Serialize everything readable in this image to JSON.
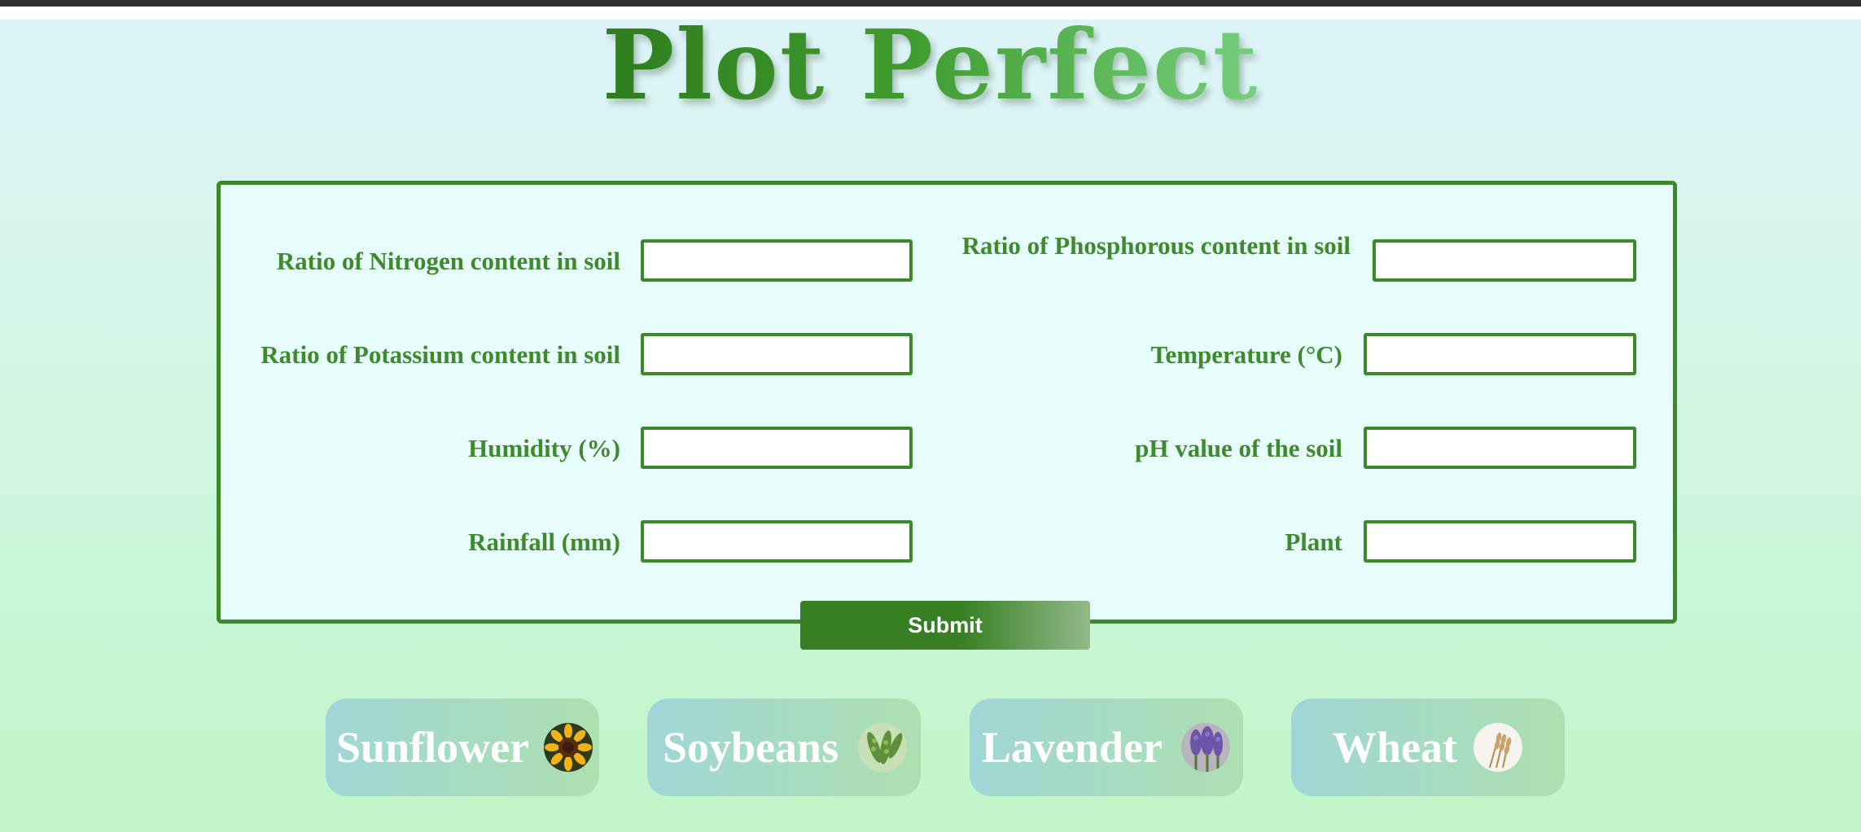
{
  "app": {
    "title": "Plot Perfect"
  },
  "form": {
    "fields": [
      {
        "label": "Ratio of Nitrogen content in soil",
        "value": "",
        "placeholder": ""
      },
      {
        "label": "Ratio of Phosphorous content in soil",
        "value": "",
        "placeholder": ""
      },
      {
        "label": "Ratio of Potassium content in soil",
        "value": "",
        "placeholder": ""
      },
      {
        "label": "Temperature (°C)",
        "value": "",
        "placeholder": ""
      },
      {
        "label": "Humidity (%)",
        "value": "",
        "placeholder": ""
      },
      {
        "label": "pH value of the soil",
        "value": "",
        "placeholder": ""
      },
      {
        "label": "Rainfall (mm)",
        "value": "",
        "placeholder": ""
      },
      {
        "label": "Plant",
        "value": "",
        "placeholder": ""
      }
    ],
    "submit_label": "Submit"
  },
  "plants": [
    {
      "name": "Sunflower",
      "icon": "sunflower-icon"
    },
    {
      "name": "Soybeans",
      "icon": "soybeans-icon"
    },
    {
      "name": "Lavender",
      "icon": "lavender-icon"
    },
    {
      "name": "Wheat",
      "icon": "wheat-icon"
    }
  ],
  "colors": {
    "accent_green": "#3a8a2a",
    "submit_green": "#367f22",
    "form_background": "#e6fdfb",
    "card_gradient_start": "#a0d6d6",
    "card_gradient_end": "#ade0b0"
  }
}
